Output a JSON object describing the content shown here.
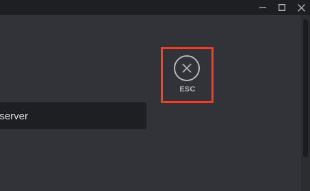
{
  "window_controls": {
    "minimize_icon": "minimize-icon",
    "maximize_icon": "maximize-icon",
    "close_icon": "close-icon"
  },
  "esc_button": {
    "icon": "close-circle-icon",
    "label": "ESC",
    "highlight_color": "#ff3b1f"
  },
  "server_field": {
    "value": "server"
  },
  "colors": {
    "background": "#313338",
    "titlebar": "#1e1f22",
    "input_background": "#1e1f22",
    "text": "#dbdee1",
    "muted": "#b5bac1"
  }
}
